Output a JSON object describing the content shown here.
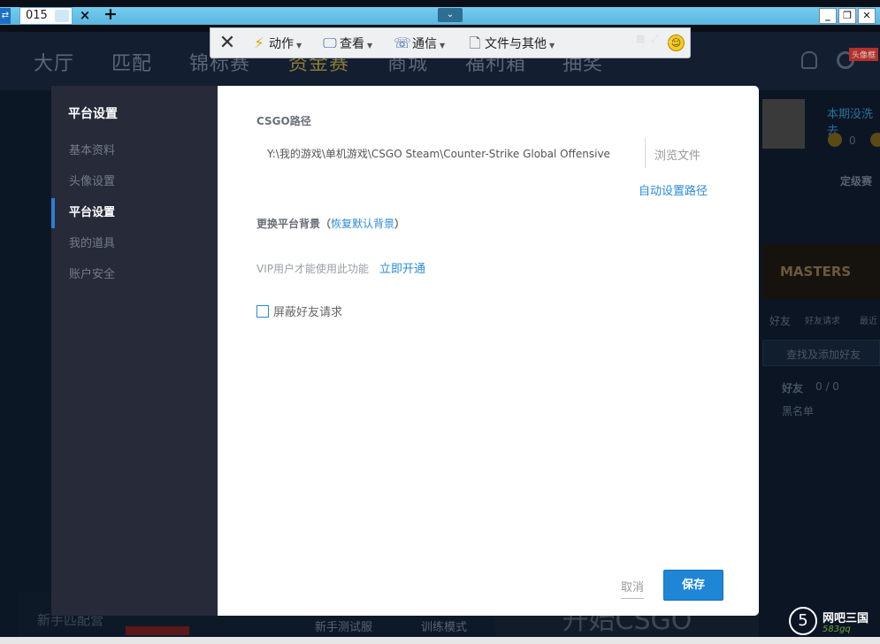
{
  "session": {
    "tab_label": "015",
    "tab_close": "×",
    "tab_add": "+",
    "menu_caret": "⌄",
    "min_label": "_",
    "max_label": "❐",
    "close_label": "✕"
  },
  "remote_toolbar": {
    "close_glyph": "✕",
    "items": [
      {
        "label": "动作",
        "icon": "lightning-icon"
      },
      {
        "label": "查看",
        "icon": "monitor-icon"
      },
      {
        "label": "通信",
        "icon": "phone-chat-icon"
      },
      {
        "label": "文件与其他",
        "icon": "file-transfer-icon"
      }
    ],
    "emoji_icon": "smiley-icon"
  },
  "background_app": {
    "nav": [
      "大厅",
      "匹配",
      "锦标赛",
      "资金赛",
      "商城",
      "福利箱",
      "抽奖"
    ],
    "vip_badge": "头像框",
    "profile_name": "本期没洗去",
    "coin_value": "0",
    "rank_label": "定级赛",
    "masters": "MASTERS",
    "friend_tabs": [
      "好友",
      "好友请求",
      "最近"
    ],
    "search_placeholder": "查找及添加好友",
    "friends_header": "好友",
    "friends_count": "0 / 0",
    "blacklist": "黑名单",
    "bottom_left": "新手匹配营",
    "bottom_test": "新手测试服",
    "bottom_train": "训练模式",
    "start_button": "开始CSGO"
  },
  "settings_dialog": {
    "sidebar": {
      "title": "平台设置",
      "items": [
        {
          "label": "基本资料",
          "active": false
        },
        {
          "label": "头像设置",
          "active": false
        },
        {
          "label": "平台设置",
          "active": true
        },
        {
          "label": "我的道具",
          "active": false
        },
        {
          "label": "账户安全",
          "active": false
        }
      ]
    },
    "csgo_path_label": "CSGO路径",
    "csgo_path_value": "Y:\\我的游戏\\单机游戏\\CSGO Steam\\Counter-Strike Global Offensive",
    "browse_label": "浏览文件",
    "auto_path_label": "自动设置路径",
    "background_label": "更换平台背景",
    "background_open": "（",
    "restore_default_label": "恢复默认背景",
    "background_close": "）",
    "vip_note": "VIP用户才能使用此功能",
    "vip_open_label": "立即开通",
    "block_friend_label": "屏蔽好友请求",
    "block_friend_checked": false,
    "cancel_label": "取消",
    "save_label": "保存"
  },
  "watermark": {
    "glyph": "5",
    "text": "网吧三国",
    "sub": "583gq"
  },
  "colors": {
    "accent": "#2a8ad8",
    "save_button": "#1f86d6",
    "sidebar_bg": "#262a39",
    "active_indicator": "#2f7bd6"
  }
}
